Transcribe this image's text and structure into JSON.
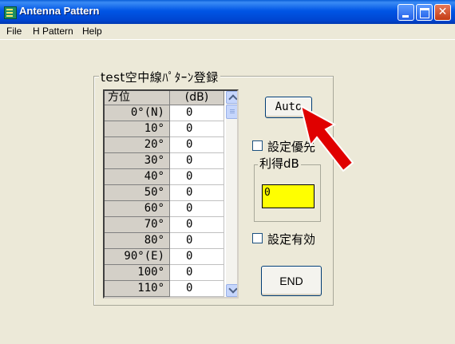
{
  "window": {
    "title": "Antenna Pattern"
  },
  "menu": [
    "File",
    "H Pattern",
    "Help"
  ],
  "group": {
    "title": "test空中線ﾊﾟﾀｰﾝ登録",
    "table": {
      "headers": [
        "方位",
        "(dB)"
      ],
      "rows": [
        {
          "azimuth": "0°(N)",
          "db": "0"
        },
        {
          "azimuth": "10°",
          "db": "0"
        },
        {
          "azimuth": "20°",
          "db": "0"
        },
        {
          "azimuth": "30°",
          "db": "0"
        },
        {
          "azimuth": "40°",
          "db": "0"
        },
        {
          "azimuth": "50°",
          "db": "0"
        },
        {
          "azimuth": "60°",
          "db": "0"
        },
        {
          "azimuth": "70°",
          "db": "0"
        },
        {
          "azimuth": "80°",
          "db": "0"
        },
        {
          "azimuth": "90°(E)",
          "db": "0"
        },
        {
          "azimuth": "100°",
          "db": "0"
        },
        {
          "azimuth": "110°",
          "db": "0"
        }
      ]
    }
  },
  "controls": {
    "auto_label": "Auto",
    "priority_label": "設定優先",
    "gain_group_title": "利得dB",
    "gain_value": "0",
    "valid_label": "設定有効",
    "end_label": "END"
  },
  "colors": {
    "title_bar": "#0055e5",
    "gain_field": "#ffff00",
    "arrow": "#e00000"
  }
}
